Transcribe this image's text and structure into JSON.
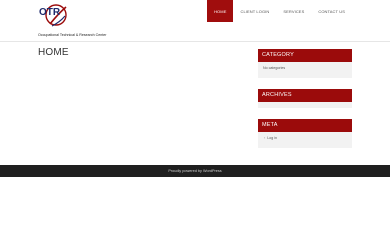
{
  "site": {
    "logo_text": "OTR",
    "tagline": "Occupational Technical & Research Center"
  },
  "nav": {
    "items": [
      {
        "label": "HOME"
      },
      {
        "label": "CLIENT LOGIN"
      },
      {
        "label": "SERVICES"
      },
      {
        "label": "CONTACT US"
      }
    ],
    "active_index": 0,
    "accent_color": "#a00d0d"
  },
  "main": {
    "title": "HOME"
  },
  "sidebar": {
    "category": {
      "title": "CATEGORY",
      "body": "No categories"
    },
    "archives": {
      "title": "ARCHIVES"
    },
    "meta": {
      "title": "META",
      "link": "Log in"
    }
  },
  "footer": {
    "text": "Proudly powered by WordPress"
  }
}
